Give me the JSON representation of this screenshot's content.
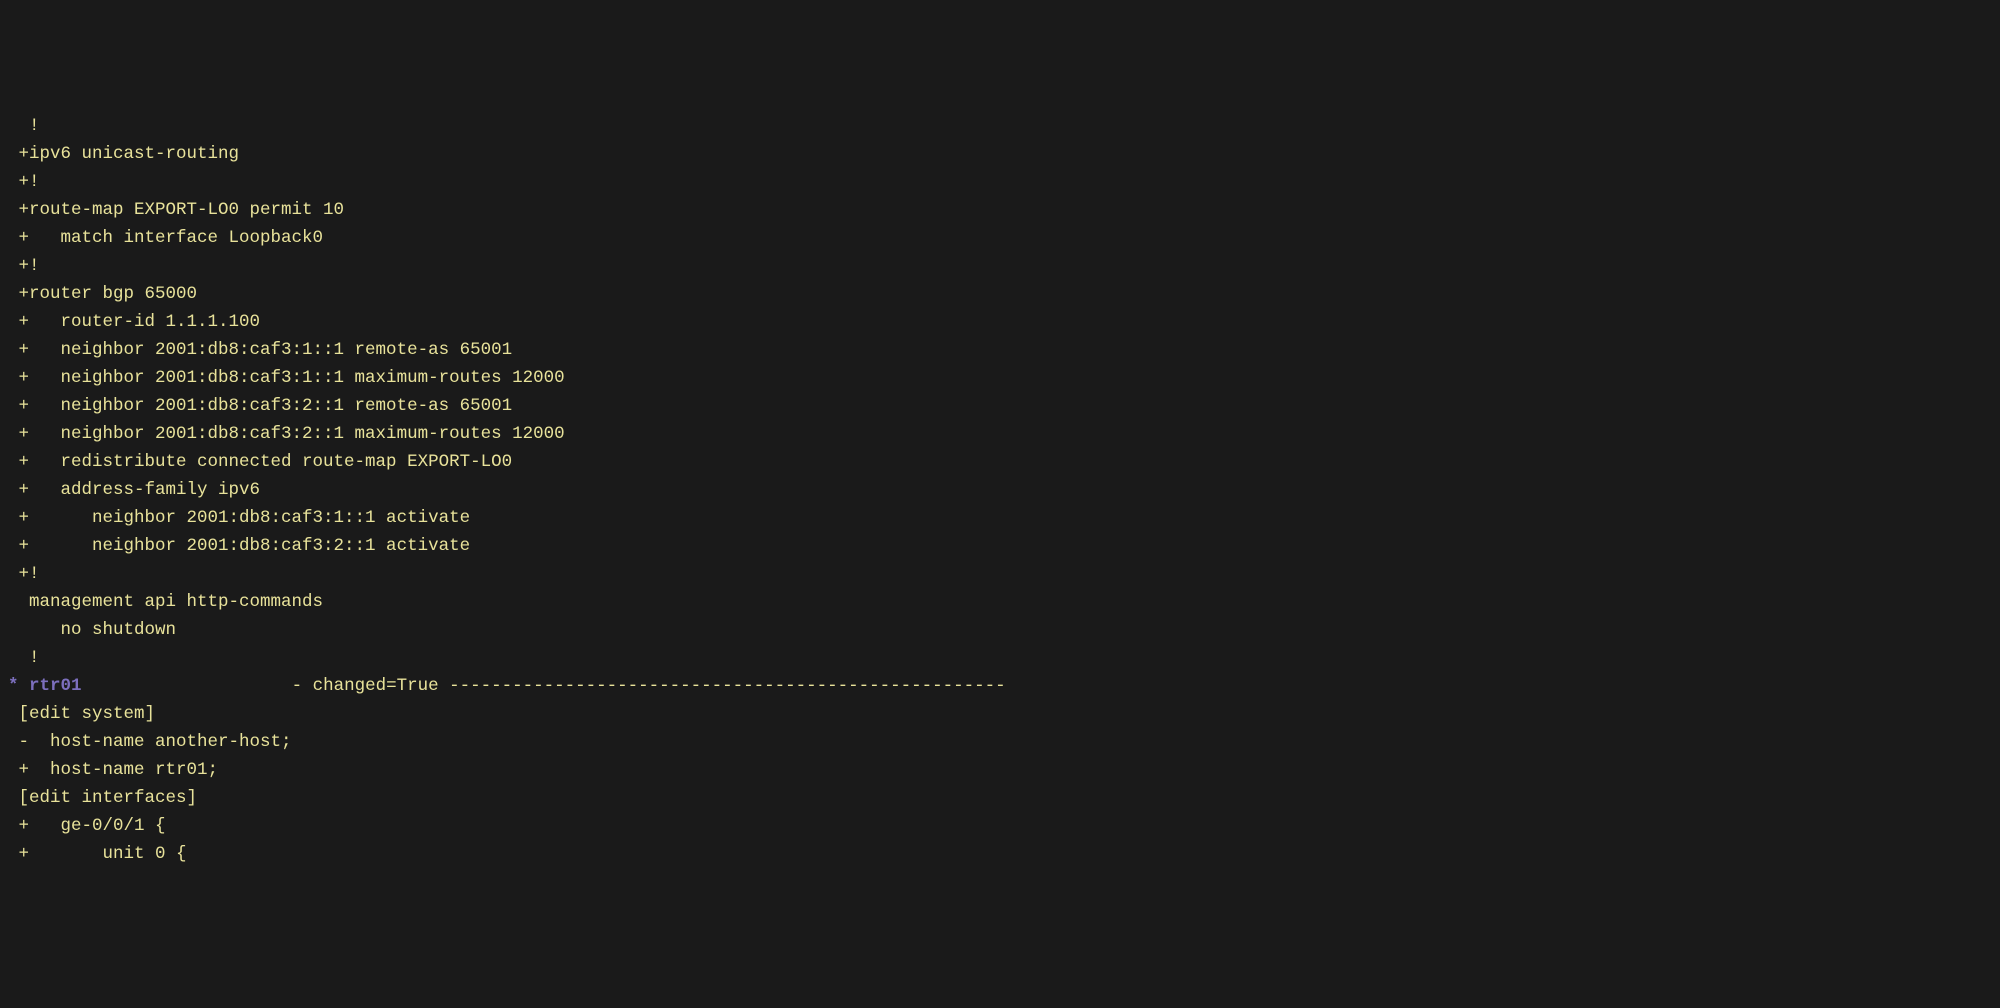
{
  "lines": [
    {
      "segments": [
        {
          "text": "  !",
          "class": "normal"
        }
      ]
    },
    {
      "segments": [
        {
          "text": " +ipv6 unicast-routing",
          "class": "normal"
        }
      ]
    },
    {
      "segments": [
        {
          "text": " +!",
          "class": "normal"
        }
      ]
    },
    {
      "segments": [
        {
          "text": " +route-map EXPORT-LO0 permit 10",
          "class": "normal"
        }
      ]
    },
    {
      "segments": [
        {
          "text": " +   match interface Loopback0",
          "class": "normal"
        }
      ]
    },
    {
      "segments": [
        {
          "text": " +!",
          "class": "normal"
        }
      ]
    },
    {
      "segments": [
        {
          "text": " +router bgp 65000",
          "class": "normal"
        }
      ]
    },
    {
      "segments": [
        {
          "text": " +   router-id 1.1.1.100",
          "class": "normal"
        }
      ]
    },
    {
      "segments": [
        {
          "text": " +   neighbor 2001:db8:caf3:1::1 remote-as 65001",
          "class": "normal"
        }
      ]
    },
    {
      "segments": [
        {
          "text": " +   neighbor 2001:db8:caf3:1::1 maximum-routes 12000",
          "class": "normal"
        }
      ]
    },
    {
      "segments": [
        {
          "text": " +   neighbor 2001:db8:caf3:2::1 remote-as 65001",
          "class": "normal"
        }
      ]
    },
    {
      "segments": [
        {
          "text": " +   neighbor 2001:db8:caf3:2::1 maximum-routes 12000",
          "class": "normal"
        }
      ]
    },
    {
      "segments": [
        {
          "text": " +   redistribute connected route-map EXPORT-LO0",
          "class": "normal"
        }
      ]
    },
    {
      "segments": [
        {
          "text": " +   address-family ipv6",
          "class": "normal"
        }
      ]
    },
    {
      "segments": [
        {
          "text": " +      neighbor 2001:db8:caf3:1::1 activate",
          "class": "normal"
        }
      ]
    },
    {
      "segments": [
        {
          "text": " +      neighbor 2001:db8:caf3:2::1 activate",
          "class": "normal"
        }
      ]
    },
    {
      "segments": [
        {
          "text": " +!",
          "class": "normal"
        }
      ]
    },
    {
      "segments": [
        {
          "text": "  management api http-commands",
          "class": "normal"
        }
      ]
    },
    {
      "segments": [
        {
          "text": "     no shutdown",
          "class": "normal"
        }
      ]
    },
    {
      "segments": [
        {
          "text": "  !",
          "class": "normal"
        }
      ]
    },
    {
      "segments": [
        {
          "text": "* ",
          "class": "purple bold"
        },
        {
          "text": "rtr01",
          "class": "purple bold"
        },
        {
          "text": "                    - changed=True -----------------------------------------------------",
          "class": "normal"
        }
      ]
    },
    {
      "segments": [
        {
          "text": " [edit system]",
          "class": "normal"
        }
      ]
    },
    {
      "segments": [
        {
          "text": " -  host-name another-host;",
          "class": "normal"
        }
      ]
    },
    {
      "segments": [
        {
          "text": " +  host-name rtr01;",
          "class": "normal"
        }
      ]
    },
    {
      "segments": [
        {
          "text": " [edit interfaces]",
          "class": "normal"
        }
      ]
    },
    {
      "segments": [
        {
          "text": " +   ge-0/0/1 {",
          "class": "normal"
        }
      ]
    },
    {
      "segments": [
        {
          "text": " +       unit 0 {",
          "class": "normal"
        }
      ]
    }
  ]
}
